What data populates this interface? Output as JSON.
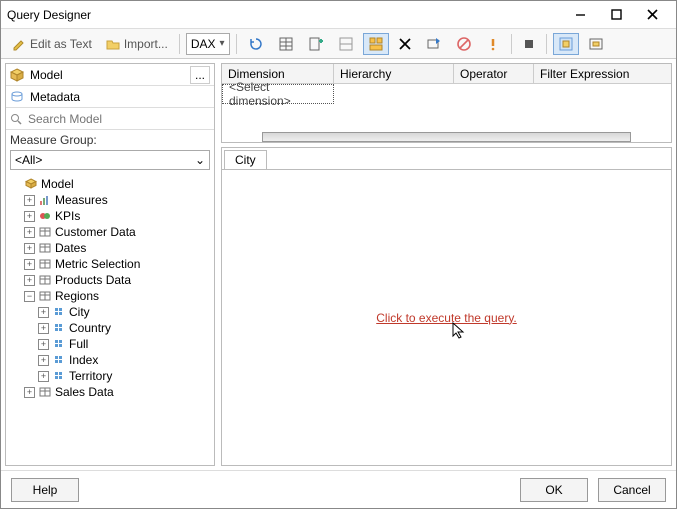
{
  "window": {
    "title": "Query Designer"
  },
  "toolbar": {
    "edit_as_text": "Edit as Text",
    "import": "Import...",
    "lang": "DAX"
  },
  "left": {
    "model_tab": "Model",
    "metadata_tab": "Metadata",
    "search_placeholder": "Search Model",
    "measure_group_label": "Measure Group:",
    "measure_group_value": "<All>",
    "tree": {
      "root": "Model",
      "measures": "Measures",
      "kpis": "KPIs",
      "customer_data": "Customer Data",
      "dates": "Dates",
      "metric_selection": "Metric Selection",
      "products_data": "Products Data",
      "regions": "Regions",
      "city": "City",
      "country": "Country",
      "full": "Full",
      "index": "Index",
      "territory": "Territory",
      "sales_data": "Sales Data"
    }
  },
  "grid": {
    "col_dimension": "Dimension",
    "col_hierarchy": "Hierarchy",
    "col_operator": "Operator",
    "col_filter": "Filter Expression",
    "select_dimension": "<Select dimension>"
  },
  "result": {
    "tab": "City",
    "exec_link": "Click to execute the query."
  },
  "footer": {
    "help": "Help",
    "ok": "OK",
    "cancel": "Cancel"
  },
  "colors": {
    "accent": "#3478c8",
    "link": "#c0392b"
  }
}
